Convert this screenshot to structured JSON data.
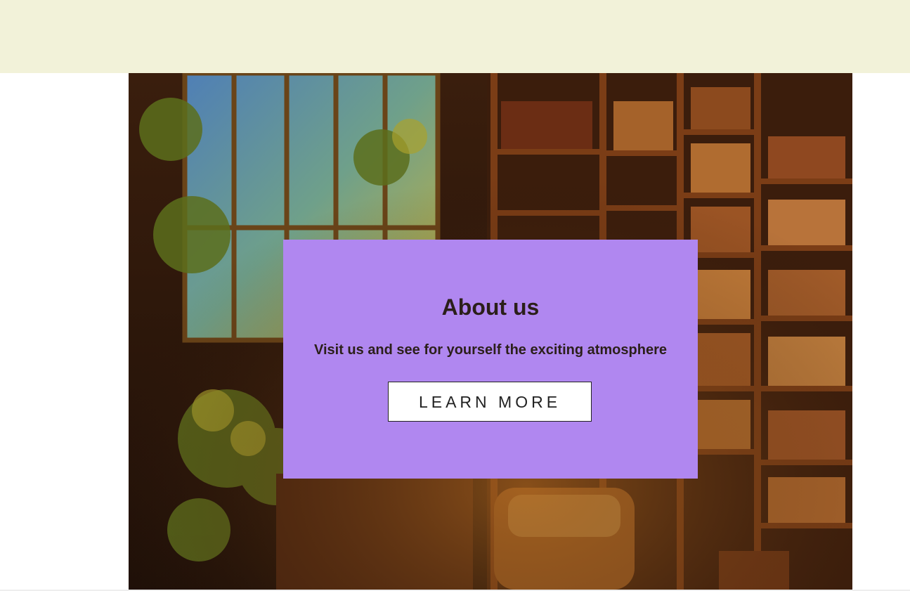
{
  "hero": {
    "image_alt": "cozy library room with bookshelves, window and armchair",
    "colors": {
      "topbar": "#f2f2d9",
      "card": "#b087f0"
    }
  },
  "about": {
    "title": "About us",
    "subtitle": "Visit us and see for yourself the exciting atmosphere",
    "button_label": "LEARN MORE"
  }
}
